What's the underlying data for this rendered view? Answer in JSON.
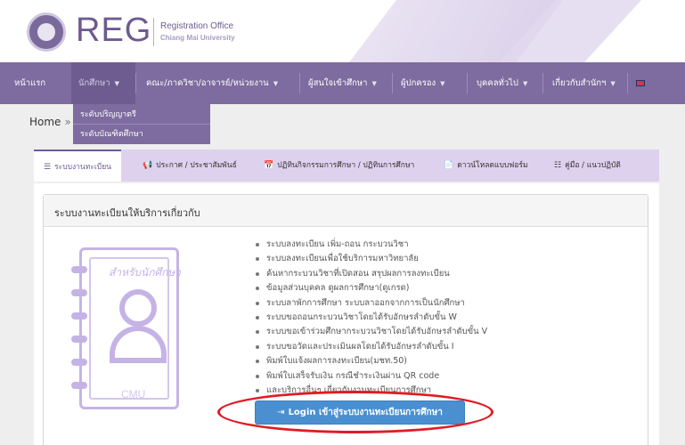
{
  "header": {
    "logo_text": "REG",
    "office_name": "Registration Office",
    "university_name": "Chiang Mai University"
  },
  "nav": {
    "items": [
      {
        "label": "หน้าแรก",
        "has_caret": false
      },
      {
        "label": "นักศึกษา",
        "has_caret": true
      },
      {
        "label": "คณะ/ภาควิชา/อาจารย์/หน่วยงาน",
        "has_caret": true
      },
      {
        "label": "ผู้สนใจเข้าศึกษา",
        "has_caret": true
      },
      {
        "label": "ผู้ปกครอง",
        "has_caret": true
      },
      {
        "label": "บุคคลทั่วไป",
        "has_caret": true
      },
      {
        "label": "เกี่ยวกับสำนักฯ",
        "has_caret": true
      }
    ],
    "caret_glyph": "▼",
    "language_flag": "uk-flag-icon"
  },
  "dropdown": {
    "items": [
      "ระดับปริญญาตรี",
      "ระดับบัณฑิตศึกษา"
    ]
  },
  "breadcrumb": {
    "home": "Home",
    "separator": "»"
  },
  "tabs": [
    {
      "label": "ระบบงานทะเบียน",
      "icon": "stack-icon",
      "glyph": "☰",
      "active": true
    },
    {
      "label": "ประกาศ / ประชาสัมพันธ์",
      "icon": "megaphone-icon",
      "glyph": "📢",
      "active": false
    },
    {
      "label": "ปฏิทินกิจกรรมการศึกษา / ปฏิทินการศึกษา",
      "icon": "calendar-icon",
      "glyph": "📅",
      "active": false
    },
    {
      "label": "ดาวน์โหลดแบบฟอร์ม",
      "icon": "file-icon",
      "glyph": "📄",
      "active": false
    },
    {
      "label": "คู่มือ / แนวปฏิบัติ",
      "icon": "list-icon",
      "glyph": "☷",
      "active": false
    }
  ],
  "panel": {
    "title": "ระบบงานทะเบียนให้บริการเกี่ยวกับ",
    "illustration_label": "สำหรับนักศึกษา",
    "illustration_footer": "CMU",
    "services": [
      "ระบบลงทะเบียน เพิ่ม-ถอน กระบวนวิชา",
      "ระบบลงทะเบียนเพื่อใช้บริการมหาวิทยาลัย",
      "ค้นหากระบวนวิชาที่เปิดสอน สรุปผลการลงทะเบียน",
      "ข้อมูลส่วนบุคคล ดูผลการศึกษา(ดูเกรด)",
      "ระบบลาพักการศึกษา ระบบลาออกจากการเป็นนักศึกษา",
      "ระบบขอถอนกระบวนวิชาโดยได้รับอักษรลำดับขั้น W",
      "ระบบขอเข้าร่วมศึกษากระบวนวิชาโดยได้รับอักษรลำดับขั้น V",
      "ระบบขอวัดและประเมินผลโดยได้รับอักษรลำดับขั้น I",
      "พิมพ์ใบแจ้งผลการลงทะเบียน(มชท.50)",
      "พิมพ์ใบเสร็จรับเงิน กรณีชำระเงินผ่าน QR code",
      "และบริการอื่นๆ เกี่ยวกับงานทะเบียนการศึกษา"
    ],
    "login_button": "Login เข้าสู่ระบบงานทะเบียนการศึกษา",
    "login_icon": "sign-in-icon"
  },
  "colors": {
    "nav_bg": "#7e6b9f",
    "brand": "#6d5b8f",
    "tab_bar": "#ded1ee",
    "button_blue": "#4a90d0",
    "highlight_red": "#e01b24",
    "illustration": "#c5b3e6"
  }
}
